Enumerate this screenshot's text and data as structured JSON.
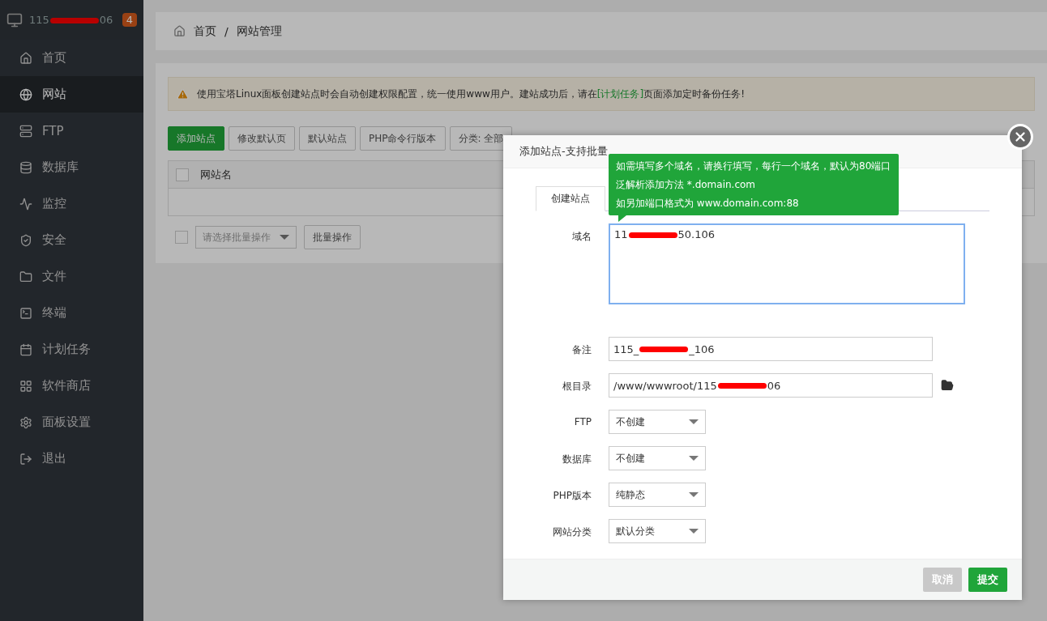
{
  "sidebar": {
    "server": {
      "before": "115",
      "after": "06"
    },
    "badge": "4",
    "items": [
      {
        "label": "首页",
        "selected": false
      },
      {
        "label": "网站",
        "selected": true
      },
      {
        "label": "FTP",
        "selected": false
      },
      {
        "label": "数据库",
        "selected": false
      },
      {
        "label": "监控",
        "selected": false
      },
      {
        "label": "安全",
        "selected": false
      },
      {
        "label": "文件",
        "selected": false
      },
      {
        "label": "终端",
        "selected": false
      },
      {
        "label": "计划任务",
        "selected": false
      },
      {
        "label": "软件商店",
        "selected": false
      },
      {
        "label": "面板设置",
        "selected": false
      },
      {
        "label": "退出",
        "selected": false
      }
    ]
  },
  "breadcrumb": [
    "首页",
    "网站管理"
  ],
  "breadcrumb_separator": "/",
  "notice": {
    "text": "使用宝塔Linux面板创建站点时会自动创建权限配置，统一使用www用户。建站成功后，请在",
    "link": "[计划任务]",
    "after": "页面添加定时备份任务!"
  },
  "toolbar": [
    {
      "label": "添加站点",
      "primary": true
    },
    {
      "label": "修改默认页",
      "primary": false
    },
    {
      "label": "默认站点",
      "primary": false
    },
    {
      "label": "PHP命令行版本",
      "primary": false
    },
    {
      "label": "分类: 全部",
      "primary": false
    }
  ],
  "table": {
    "columns": [
      "网站名"
    ],
    "checked": false
  },
  "batch": {
    "checked": false,
    "placeholder": "请选择批量操作",
    "button": "批量操作"
  },
  "dialog": {
    "title": "添加站点-支持批量",
    "tabs": [
      {
        "label": "创建站点",
        "selected": true
      }
    ],
    "tooltip": [
      "如需填写多个域名，请换行填写，每行一个域名，默认为80端口",
      "泛解析添加方法 *.domain.com",
      "如另加端口格式为 www.domain.com:88"
    ],
    "fields": [
      {
        "kind": "textarea",
        "label": "域名",
        "before": "11",
        "after": "50.106"
      },
      {
        "kind": "input",
        "label": "备注",
        "before": "115_",
        "after": "_106"
      },
      {
        "kind": "path",
        "label": "根目录",
        "before": "/www/wwwroot/115",
        "after": "06"
      },
      {
        "kind": "select",
        "label": "FTP",
        "value": "不创建"
      },
      {
        "kind": "select",
        "label": "数据库",
        "value": "不创建"
      },
      {
        "kind": "select",
        "label": "PHP版本",
        "value": "纯静态"
      },
      {
        "kind": "select",
        "label": "网站分类",
        "value": "默认分类"
      }
    ],
    "buttons": [
      {
        "label": "取消",
        "primary": false
      },
      {
        "label": "提交",
        "primary": true
      }
    ]
  }
}
